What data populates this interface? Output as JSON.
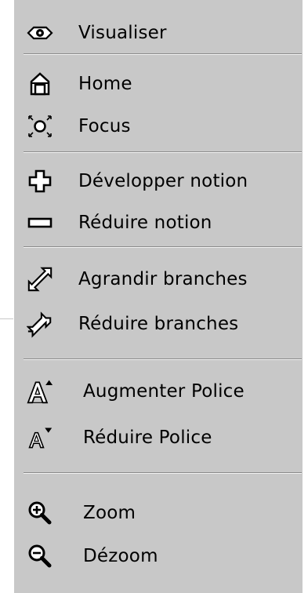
{
  "menu": {
    "items": [
      {
        "label": "Visualiser",
        "icon": "eye-icon"
      },
      {
        "label": "Home",
        "icon": "home-icon"
      },
      {
        "label": "Focus",
        "icon": "focus-icon"
      },
      {
        "label": "Développer notion",
        "icon": "plus-icon"
      },
      {
        "label": "Réduire notion",
        "icon": "minus-icon"
      },
      {
        "label": "Agrandir branches",
        "icon": "expand-branches-icon"
      },
      {
        "label": "Réduire branches",
        "icon": "reduce-branches-icon"
      },
      {
        "label": "Augmenter Police",
        "icon": "font-increase-icon"
      },
      {
        "label": "Réduire Police",
        "icon": "font-decrease-icon"
      },
      {
        "label": "Zoom",
        "icon": "zoom-in-icon"
      },
      {
        "label": "Dézoom",
        "icon": "zoom-out-icon"
      }
    ]
  },
  "colors": {
    "menu_background": "#c8c8c8",
    "separator_dark": "#8a8a8a",
    "separator_light": "#f4f4f4",
    "text": "#000000"
  }
}
